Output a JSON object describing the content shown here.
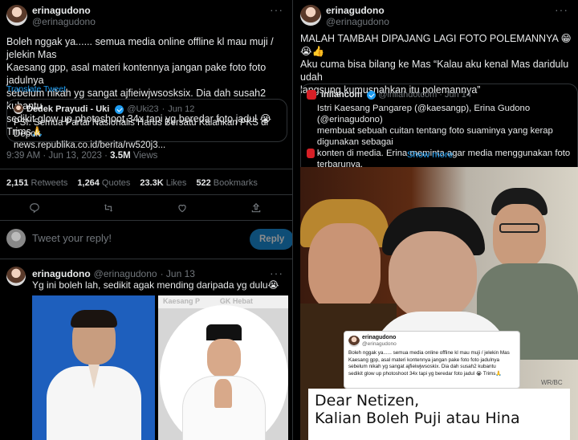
{
  "left": {
    "tweet": {
      "name": "erinagudono",
      "handle": "@erinagudono",
      "text": "Boleh nggak ya...... semua media online offline kl mau muji / jelekin Mas\nKaesang gpp, asal materi kontennya jangan pake foto foto jadulnya\nsebelum nikah yg sangat ajfieiwjwsosksix. Dia dah susah2 kubantu\nsedikit glow up photoshoot 34x tapi yg beredar foto jadul 😭 Trims🙏",
      "translate": "Translate Tweet",
      "quote": {
        "name": "Dedek Prayudi - Uki",
        "handle": "@Uki23",
        "date": "Jun 12",
        "text": "PSI: Semua Partai Nasionalis Harus Bersatu Kalahkan PKS di Depok\nnews.republika.co.id/berita/rw520j3..."
      },
      "time": "9:39 AM · Jun 13, 2023 · ",
      "views_num": "3.5M",
      "views_label": " Views",
      "stats": [
        {
          "num": "2,151",
          "label": "Retweets"
        },
        {
          "num": "1,264",
          "label": "Quotes"
        },
        {
          "num": "23.3K",
          "label": "Likes"
        },
        {
          "num": "522",
          "label": "Bookmarks"
        }
      ]
    },
    "reply_box": {
      "placeholder": "Tweet your reply!",
      "button": "Reply"
    },
    "reply": {
      "name": "erinagudono",
      "handle": "@erinagudono",
      "date": "· Jun 13",
      "text": "Yg ini boleh lah, sedikit agak mending daripada yg dulu😭",
      "banner_text": "Kaesang P          GK Hebat"
    }
  },
  "right": {
    "tweet": {
      "name": "erinagudono",
      "handle": "@erinagudono",
      "text": "MALAH TAMBAH DIPAJANG LAGI FOTO POLEMANNYA 😁😭👍\nAku cuma bisa bilang ke Mas “Kalau aku kenal Mas daridulu udah\nlangsung kumusnahkan itu polemannya”",
      "quote": {
        "name": "inilahcom",
        "handle": "@inilahdotcom",
        "date": "· Jun 14",
        "text": "Istri Kaesang Pangarep (@kaesangp), Erina Gudono (@erinagudono)\nmembuat sebuah cuitan tentang foto suaminya yang kerap digunakan sebagai\nkonten di media. Erina meminta agar media menggunakan foto terbarunya,\nbukan foto Kaesang yang sebelum 'glow up'.\n\nGimana nih menurut kawan...",
        "show_more": "Show more"
      }
    },
    "embedded_card": {
      "name": "erinagudono",
      "handle": "@erinagudono",
      "text": "Boleh nggak ya...... semua media online offline kl mau muji / jelekin Mas\nKaesang gpp, asal materi kontennya jangan pake foto foto jadulnya\nsebelum nikah yg sangat ajfieiwjwsoskix. Dia dah susah2 kubantu\nsedikit glow up photoshoot 34x tapi yg beredar foto jadul 😭 Trims🙏"
    },
    "watermark": "WR/BC",
    "poster_text": "Dear Netizen,\nKalian Boleh Puji atau Hina"
  },
  "colors": {
    "background": "#000000",
    "accent": "#1d9bf0",
    "muted": "#71767b",
    "divider": "#2f3336"
  }
}
